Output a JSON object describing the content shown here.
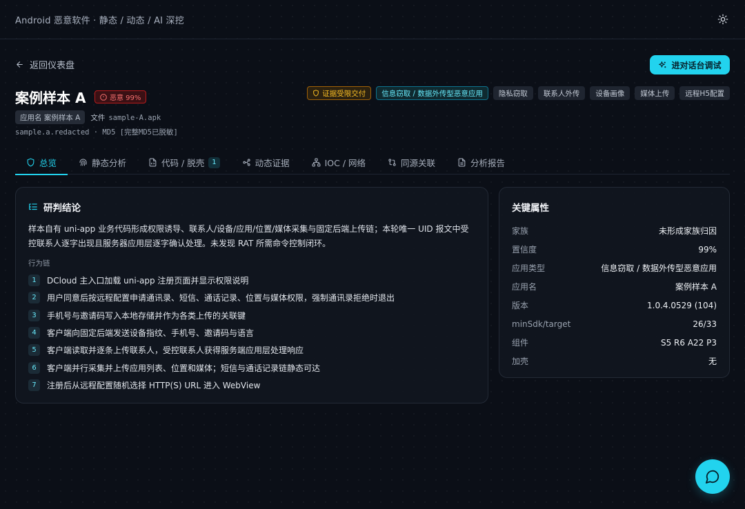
{
  "header": {
    "title": "Android 恶意软件 · 静态 / 动态 / AI 深挖"
  },
  "nav": {
    "back_label": "返回仪表盘"
  },
  "actions": {
    "debug_label": "进对话台调试"
  },
  "case": {
    "title": "案例样本 A",
    "risk_badge": "恶意 99%",
    "app_name_chip": "应用名 案例样本 A",
    "file_label": "文件",
    "file_name": "sample-A.apk",
    "package_line": "sample.a.redacted · MD5 [完整MD5已脱敏]"
  },
  "tags": [
    {
      "label": "证据受限交付",
      "style": "warn"
    },
    {
      "label": "信息窃取 / 数据外传型恶意应用",
      "style": "info"
    },
    {
      "label": "隐私窃取",
      "style": "plain"
    },
    {
      "label": "联系人外传",
      "style": "plain"
    },
    {
      "label": "设备画像",
      "style": "plain"
    },
    {
      "label": "媒体上传",
      "style": "plain"
    },
    {
      "label": "远程H5配置",
      "style": "plain"
    }
  ],
  "tabs": [
    {
      "label": "总览",
      "icon": "shield-icon",
      "active": true
    },
    {
      "label": "静态分析",
      "icon": "fingerprint-icon"
    },
    {
      "label": "代码 / 脱壳",
      "icon": "code-file-icon",
      "count": "1"
    },
    {
      "label": "动态证据",
      "icon": "workflow-icon"
    },
    {
      "label": "IOC / 网络",
      "icon": "network-icon"
    },
    {
      "label": "同源关联",
      "icon": "git-compare-icon"
    },
    {
      "label": "分析报告",
      "icon": "document-icon"
    }
  ],
  "conclusion": {
    "title": "研判结论",
    "summary": "样本自有 uni-app 业务代码形成权限诱导、联系人/设备/应用/位置/媒体采集与固定后端上传链；本轮唯一 UID 报文中受控联系人逐字出现且服务器应用层逐字确认处理。未发现 RAT 所需命令控制闭环。",
    "chain_label": "行为链",
    "chain": [
      {
        "num": "1",
        "text": "DCloud 主入口加载 uni-app 注册页面并显示权限说明"
      },
      {
        "num": "2",
        "text": "用户同意后按远程配置申请通讯录、短信、通话记录、位置与媒体权限，强制通讯录拒绝时退出"
      },
      {
        "num": "3",
        "text": "手机号与邀请码写入本地存储并作为各类上传的关联键"
      },
      {
        "num": "4",
        "text": "客户端向固定后端发送设备指纹、手机号、邀请码与语言"
      },
      {
        "num": "5",
        "text": "客户端读取并逐条上传联系人，受控联系人获得服务端应用层处理响应"
      },
      {
        "num": "6",
        "text": "客户端并行采集并上传应用列表、位置和媒体；短信与通话记录链静态可达"
      },
      {
        "num": "7",
        "text": "注册后从远程配置随机选择 HTTP(S) URL 进入 WebView"
      }
    ]
  },
  "attributes": {
    "title": "关键属性",
    "rows": [
      {
        "key": "家族",
        "value": "未形成家族归因"
      },
      {
        "key": "置信度",
        "value": "99%"
      },
      {
        "key": "应用类型",
        "value": "信息窃取 / 数据外传型恶意应用"
      },
      {
        "key": "应用名",
        "value": "案例样本 A"
      },
      {
        "key": "版本",
        "value": "1.0.4.0529 (104)"
      },
      {
        "key": "minSdk/target",
        "value": "26/33"
      },
      {
        "key": "组件",
        "value": "S5 R6 A22 P3"
      },
      {
        "key": "加壳",
        "value": "无"
      }
    ]
  },
  "colors": {
    "accent": "#22d3ee",
    "danger": "#f87171",
    "warning": "#fbbf24",
    "background": "#0b0f17"
  }
}
